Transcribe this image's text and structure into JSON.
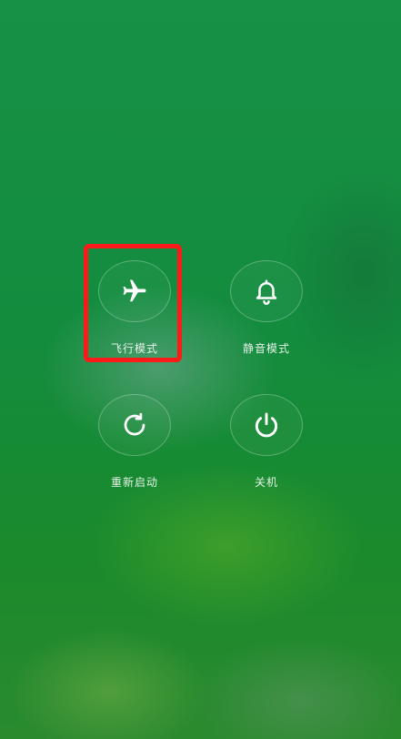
{
  "power_menu": {
    "airplane_mode": {
      "label": "飞行模式",
      "icon": "airplane-icon"
    },
    "silent_mode": {
      "label": "静音模式",
      "icon": "bell-icon"
    },
    "restart": {
      "label": "重新启动",
      "icon": "restart-icon"
    },
    "power_off": {
      "label": "关机",
      "icon": "power-icon"
    }
  },
  "annotation": {
    "highlight_color": "#ff1a1a",
    "highlighted_item": "airplane_mode"
  },
  "colors": {
    "background": "#179146",
    "icon": "#ffffff"
  }
}
